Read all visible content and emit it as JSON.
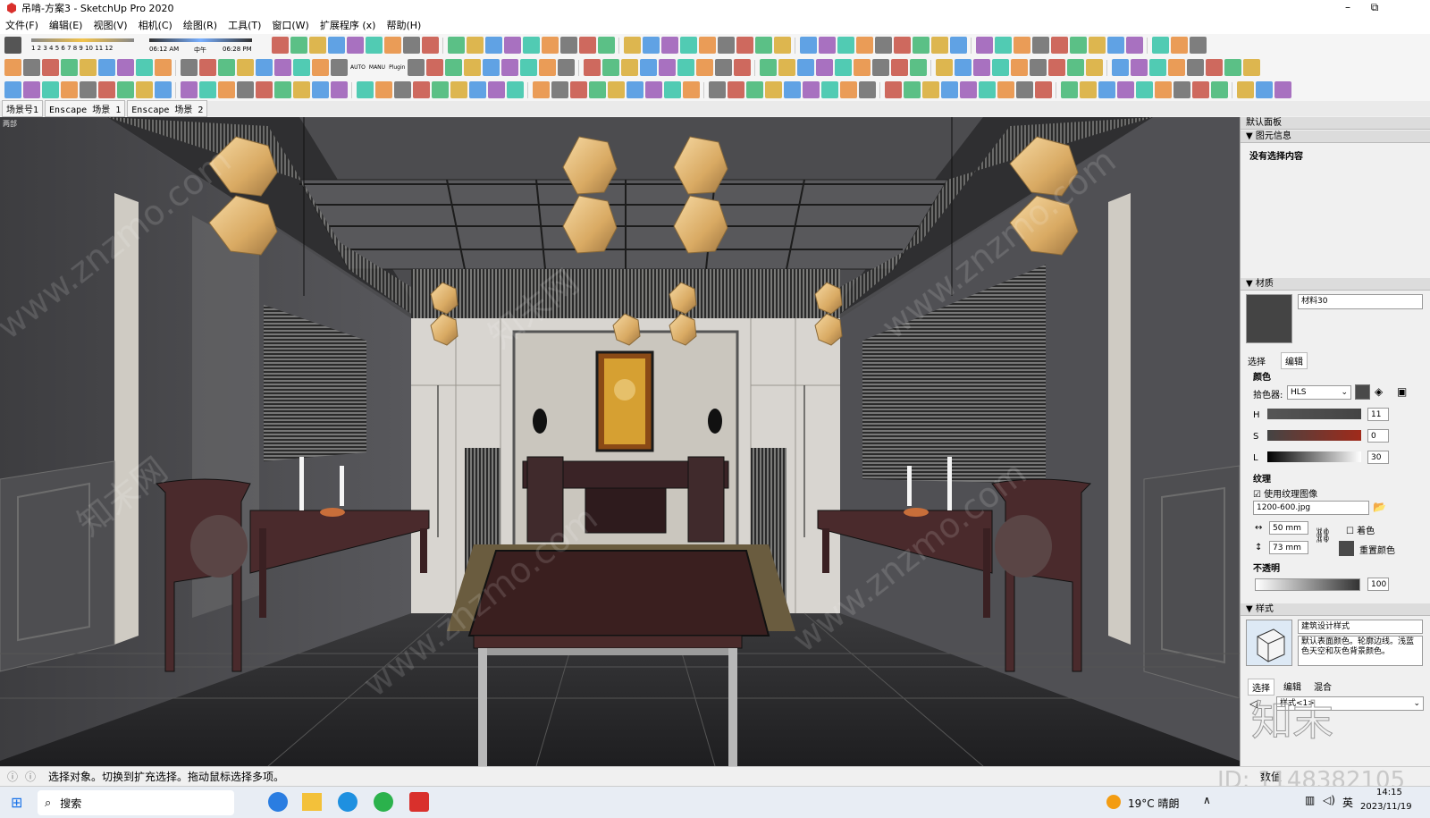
{
  "window": {
    "title": "吊啃-方案3 - SketchUp Pro 2020",
    "minimize": "–",
    "maximize": "⧉"
  },
  "menu": [
    "文件(F)",
    "编辑(E)",
    "视图(V)",
    "相机(C)",
    "绘图(R)",
    "工具(T)",
    "窗口(W)",
    "扩展程序 (x)",
    "帮助(H)"
  ],
  "shadow": {
    "months": "1 2 3 4 5 6 7 8 9 10 11 12",
    "time_start": "06:12 AM",
    "noon": "中午",
    "time_end": "06:28 PM"
  },
  "toolbar_plugin_labels": [
    "AUTO",
    "MANU",
    "Plugin"
  ],
  "scene_tabs": [
    "场景号1",
    "Enscape 场景 1",
    "Enscape 场景 2"
  ],
  "viewport": {
    "label": "两部",
    "watermark": "www.znzmo.com",
    "watermark_brand": "知末网"
  },
  "panel": {
    "title": "默认面板",
    "entity": {
      "header": "图元信息",
      "empty": "没有选择内容"
    },
    "materials": {
      "header": "材质",
      "name": "材料30",
      "tabs": [
        "选择",
        "编辑"
      ],
      "color_label": "颜色",
      "picker_label": "拾色器:",
      "picker_value": "HLS",
      "h_label": "H",
      "h_value": "11",
      "s_label": "S",
      "s_value": "0",
      "l_label": "L",
      "l_value": "30",
      "texture_label": "纹理",
      "use_texture": "使用纹理图像",
      "texture_file": "1200-600.jpg",
      "width": "50 mm",
      "height": "73 mm",
      "colorize": "着色",
      "reset_color": "重置颜色",
      "opacity_label": "不透明",
      "opacity_value": "100",
      "swatch_color": "#4a4a4a"
    },
    "styles": {
      "header": "样式",
      "name": "建筑设计样式",
      "desc": "默认表面颜色。轮廓边线。浅蓝色天空和灰色背景颜色。",
      "tabs": [
        "选择",
        "编辑",
        "混合"
      ],
      "selected": "样式<1>"
    }
  },
  "status": {
    "text": "选择对象。切换到扩充选择。拖动鼠标选择多项。",
    "measure_label": "数值"
  },
  "overlay": {
    "brand": "知末",
    "id": "ID: 1148382105"
  },
  "taskbar": {
    "search": "搜索",
    "weather": "19°C  晴朗",
    "ime": "英",
    "time": "14:15",
    "date": "2023/11/19"
  },
  "colors": {
    "icon_palette": [
      "#c0392b",
      "#2e86de",
      "#e67e22",
      "#27ae60",
      "#8e44ad",
      "#555555",
      "#d4a017",
      "#1abc9c"
    ]
  }
}
